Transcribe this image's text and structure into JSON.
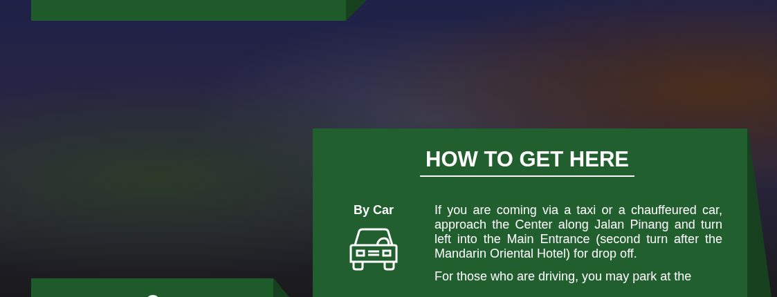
{
  "section": {
    "title": "HOW TO GET HERE",
    "items": [
      {
        "label": "By Car",
        "paragraphs": [
          "If you are coming via a taxi or a chauffeured car, approach the Center along Jalan Pinang and turn left into the Main Entrance (second turn after the Mandarin Oriental Hotel) for drop off.",
          "For those who are driving, you may park at the"
        ]
      }
    ]
  }
}
